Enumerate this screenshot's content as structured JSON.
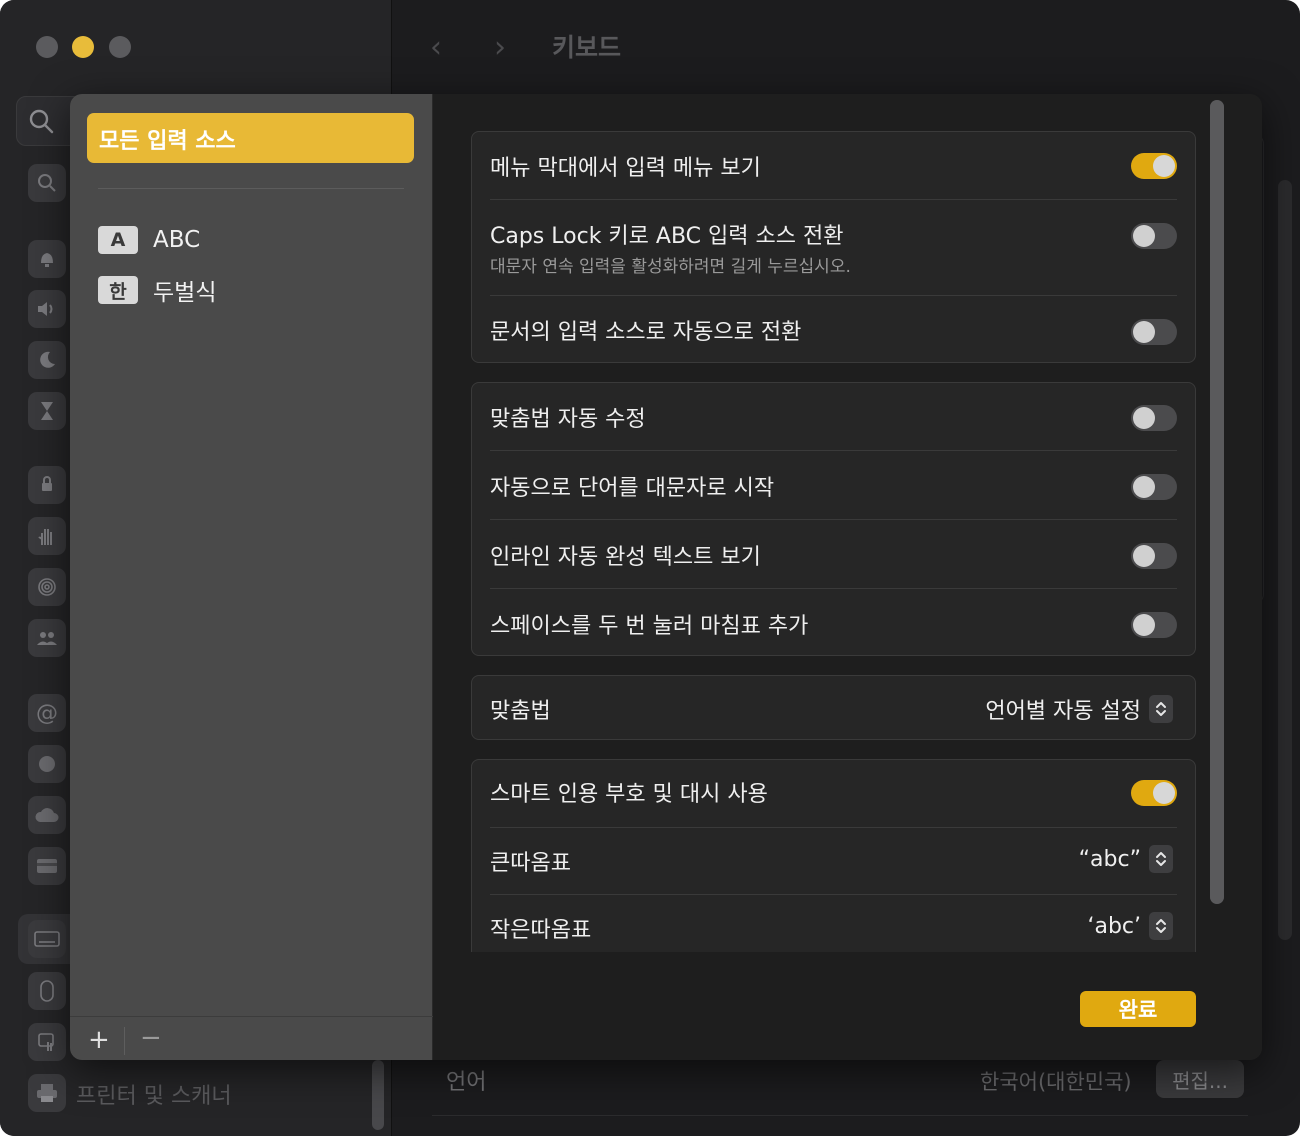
{
  "window": {
    "title": "키보드"
  },
  "sidebar": {
    "footer_item": "프린터 및 스캐너"
  },
  "background": {
    "language_label": "언어",
    "language_value": "한국어(대한민국)",
    "edit_button": "편집..."
  },
  "input_sources": {
    "all_sources": "모든 입력 소스",
    "items": [
      {
        "badge": "A",
        "label": "ABC"
      },
      {
        "badge": "한",
        "label": "두벌식"
      }
    ],
    "add_label": "+",
    "remove_label": "−"
  },
  "settings": {
    "group1": [
      {
        "label": "메뉴 막대에서 입력 메뉴 보기",
        "on": true
      },
      {
        "label": "Caps Lock 키로 ABC 입력 소스 전환",
        "sub": "대문자 연속 입력을 활성화하려면 길게 누르십시오.",
        "on": false
      },
      {
        "label": "문서의 입력 소스로 자동으로 전환",
        "on": false
      }
    ],
    "group2": [
      {
        "label": "맞춤법 자동 수정",
        "on": false
      },
      {
        "label": "자동으로 단어를 대문자로 시작",
        "on": false
      },
      {
        "label": "인라인 자동 완성 텍스트 보기",
        "on": false
      },
      {
        "label": "스페이스를 두 번 눌러 마침표 추가",
        "on": false
      }
    ],
    "spelling": {
      "label": "맞춤법",
      "value": "언어별 자동 설정"
    },
    "group4": {
      "smart_quotes": {
        "label": "스마트 인용 부호 및 대시 사용",
        "on": true
      },
      "double_quotes": {
        "label": "큰따옴표",
        "value": "“abc”"
      },
      "single_quotes": {
        "label": "작은따옴표",
        "value": "‘abc’"
      }
    }
  },
  "done_button": "완료",
  "colors": {
    "accent": "#e0a910",
    "selection": "#e8b936"
  }
}
